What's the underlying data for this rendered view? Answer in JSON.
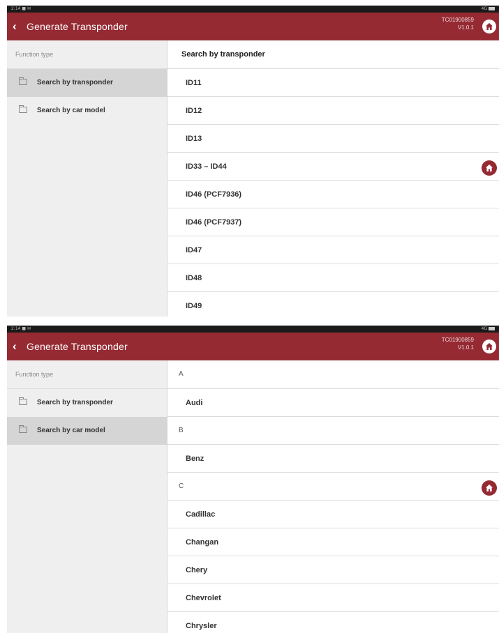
{
  "screens": [
    {
      "status_time": "2:14 ■ ✉",
      "status_right": "4G",
      "app_title": "Generate Transponder",
      "serial": "TC01900859",
      "version": "V1.0.1",
      "function_type_label": "Function type",
      "left_items": [
        {
          "label": "Search by transponder",
          "selected": true
        },
        {
          "label": "Search by car model",
          "selected": false
        }
      ],
      "list_header": "Search by transponder",
      "rows": [
        {
          "label": "ID11"
        },
        {
          "label": "ID12"
        },
        {
          "label": "ID13"
        },
        {
          "label": "ID33 – ID44"
        },
        {
          "label": "ID46 (PCF7936)"
        },
        {
          "label": "ID46 (PCF7937)"
        },
        {
          "label": "ID47"
        },
        {
          "label": "ID48"
        },
        {
          "label": "ID49"
        }
      ]
    },
    {
      "status_time": "2:14 ■ ✉",
      "status_right": "4G",
      "app_title": "Generate Transponder",
      "serial": "TC01900859",
      "version": "V1.0.1",
      "function_type_label": "Function type",
      "left_items": [
        {
          "label": "Search by transponder",
          "selected": false
        },
        {
          "label": "Search by car model",
          "selected": true
        }
      ],
      "list_header": "A",
      "rows": [
        {
          "label": "Audi",
          "letter": false
        },
        {
          "label": "B",
          "letter": true
        },
        {
          "label": "Benz",
          "letter": false
        },
        {
          "label": "C",
          "letter": true
        },
        {
          "label": "Cadillac",
          "letter": false
        },
        {
          "label": "Changan",
          "letter": false
        },
        {
          "label": "Chery",
          "letter": false
        },
        {
          "label": "Chevrolet",
          "letter": false
        },
        {
          "label": "Chrysler",
          "letter": false
        }
      ]
    }
  ],
  "colors": {
    "appbar": "#952a33",
    "statusbar": "#1a1a1a",
    "left_pane": "#efefef",
    "selected": "#d5d5d5"
  },
  "icons": {
    "back": "chevron-left-icon",
    "home": "home-icon",
    "floating": "home-icon",
    "folder": "folder-icon"
  }
}
